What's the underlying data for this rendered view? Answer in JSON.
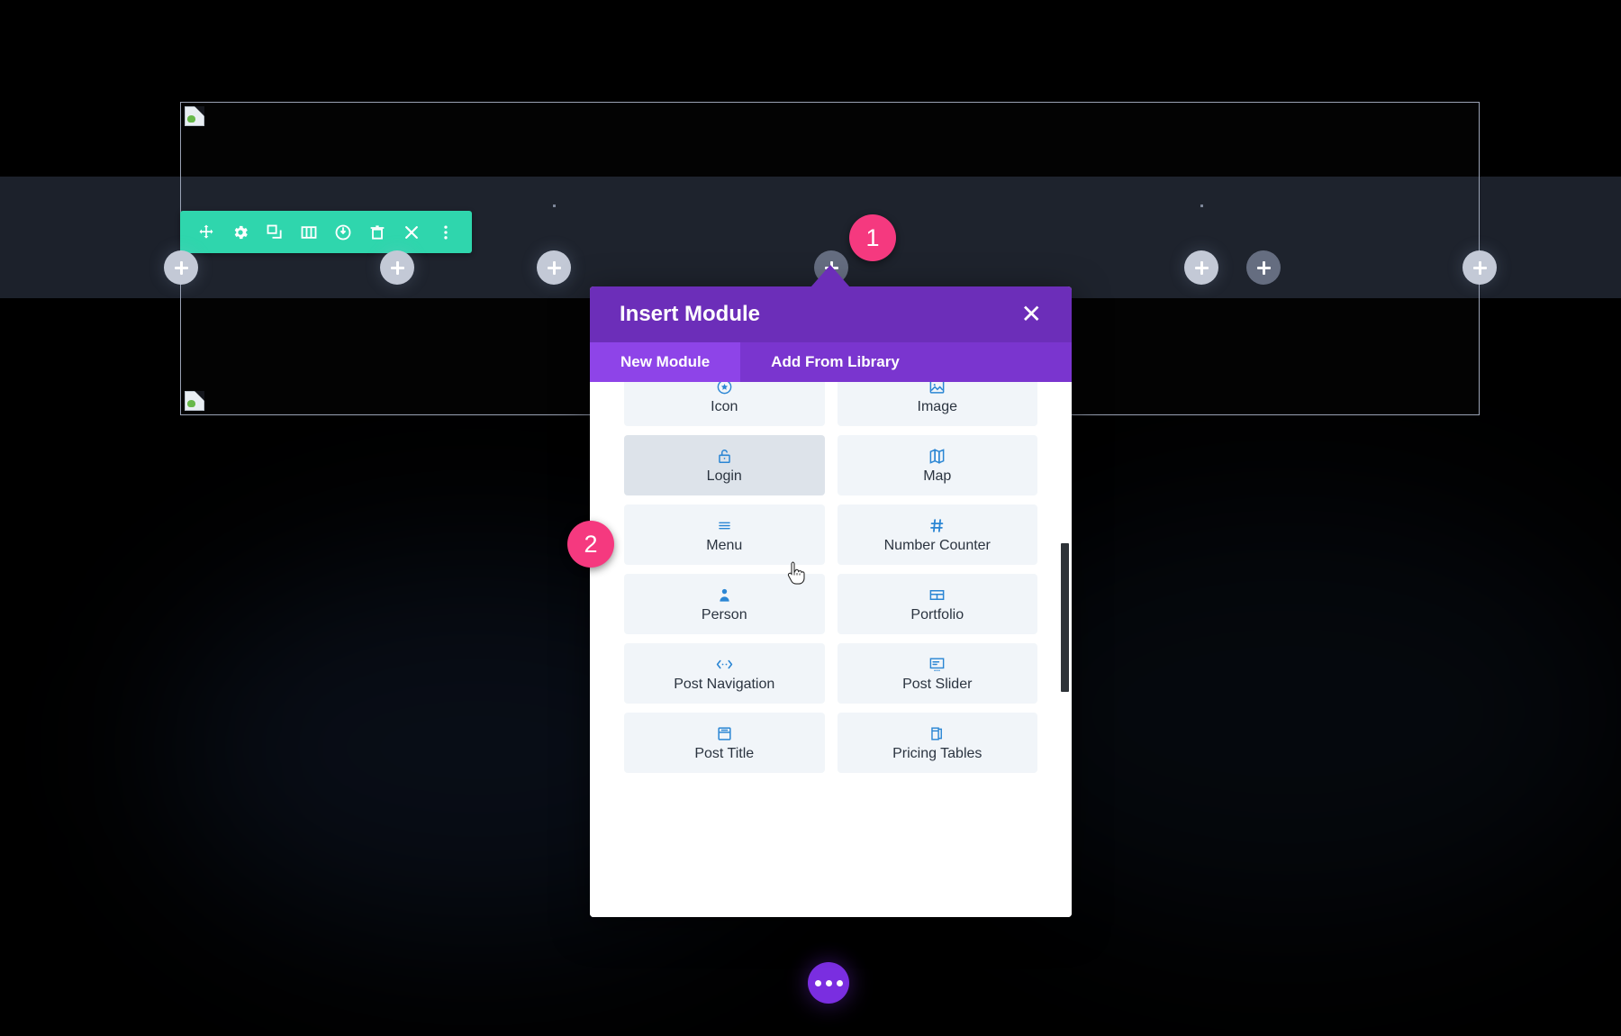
{
  "canvas": {
    "section_label": "selected-section",
    "broken_image_alt": "broken-image-placeholder"
  },
  "row_toolbar": {
    "label": "Row Settings Toolbar",
    "color": "#2fd6ad",
    "buttons": [
      {
        "name": "move-handle-icon",
        "title": "Move Row"
      },
      {
        "name": "gear-icon",
        "title": "Row Settings"
      },
      {
        "name": "duplicate-icon",
        "title": "Duplicate Row"
      },
      {
        "name": "columns-icon",
        "title": "Change Column Structure"
      },
      {
        "name": "power-toggle-icon",
        "title": "Disable Row"
      },
      {
        "name": "trash-icon",
        "title": "Delete Row"
      },
      {
        "name": "close-icon",
        "title": "Collapse"
      },
      {
        "name": "kebab-menu-icon",
        "title": "More Options"
      }
    ]
  },
  "add_buttons": [
    {
      "name": "add-section-left",
      "state": "normal"
    },
    {
      "name": "add-module-1",
      "state": "normal"
    },
    {
      "name": "add-module-2",
      "state": "normal"
    },
    {
      "name": "add-module-3",
      "state": "dim"
    },
    {
      "name": "add-module-4",
      "state": "normal"
    },
    {
      "name": "add-module-5",
      "state": "dim"
    },
    {
      "name": "add-section-right",
      "state": "normal"
    }
  ],
  "annotations": [
    {
      "number": "1",
      "color": "#f5397f"
    },
    {
      "number": "2",
      "color": "#f5397f"
    }
  ],
  "modal": {
    "title": "Insert Module",
    "close_label": "✕",
    "header_color": "#6c2eb9",
    "tabs": [
      {
        "label": "New Module",
        "active": true
      },
      {
        "label": "Add From Library",
        "active": false
      }
    ],
    "modules": [
      {
        "label": "",
        "icon": "partial-top-left",
        "partial": true,
        "hovered": false
      },
      {
        "label": "",
        "icon": "partial-top-right",
        "partial": true,
        "hovered": false
      },
      {
        "label": "Icon",
        "icon": "icon-star-circle",
        "partial": false,
        "hovered": false
      },
      {
        "label": "Image",
        "icon": "image-icon",
        "partial": false,
        "hovered": false
      },
      {
        "label": "Login",
        "icon": "lock-icon",
        "partial": false,
        "hovered": true
      },
      {
        "label": "Map",
        "icon": "map-icon",
        "partial": false,
        "hovered": false
      },
      {
        "label": "Menu",
        "icon": "hamburger-icon",
        "partial": false,
        "hovered": false
      },
      {
        "label": "Number Counter",
        "icon": "hash-icon",
        "partial": false,
        "hovered": false
      },
      {
        "label": "Person",
        "icon": "person-icon",
        "partial": false,
        "hovered": false
      },
      {
        "label": "Portfolio",
        "icon": "grid-icon",
        "partial": false,
        "hovered": false
      },
      {
        "label": "Post Navigation",
        "icon": "code-arrows-icon",
        "partial": false,
        "hovered": false
      },
      {
        "label": "Post Slider",
        "icon": "slider-icon",
        "partial": false,
        "hovered": false
      },
      {
        "label": "Post Title",
        "icon": "post-title-icon",
        "partial": false,
        "hovered": false
      },
      {
        "label": "Pricing Tables",
        "icon": "pricing-tables-icon",
        "partial": false,
        "hovered": false
      }
    ]
  },
  "fab": {
    "name": "builder-settings-menu",
    "color": "#7a2ee0",
    "dots": 3
  }
}
